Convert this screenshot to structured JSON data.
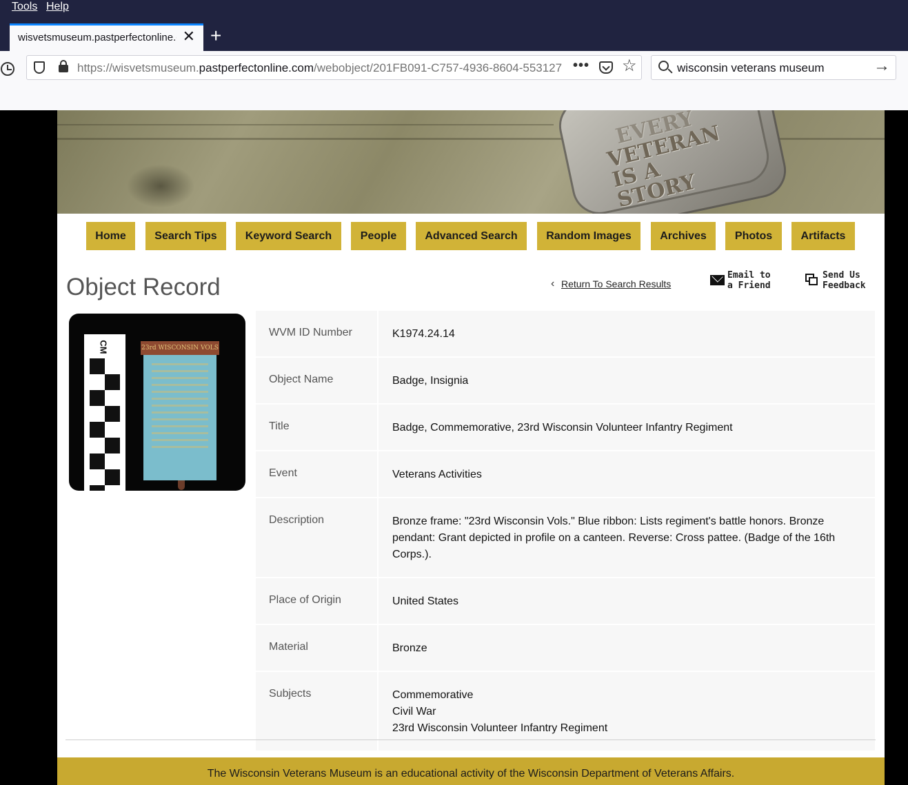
{
  "browser": {
    "menu": {
      "tools": "Tools",
      "help": "Help"
    },
    "tab": {
      "title": "wisvetsmuseum.pastperfectonline.com",
      "close": "✕"
    },
    "new_tab": "+",
    "url": {
      "prefix": "https://wisvetsmuseum.",
      "domain": "pastperfectonline.com",
      "path": "/webobject/201FB091-C757-4936-8604-553127"
    },
    "more": "•••",
    "search": {
      "value": "wisconsin veterans museum",
      "go": "→"
    },
    "star": "☆"
  },
  "banner": {
    "tag_lines": [
      "EVERY",
      "VETERAN",
      "IS A",
      "STORY"
    ]
  },
  "nav": [
    {
      "label": "Home"
    },
    {
      "label": "Search Tips"
    },
    {
      "label": "Keyword Search"
    },
    {
      "label": "People"
    },
    {
      "label": "Advanced Search"
    },
    {
      "label": "Random Images"
    },
    {
      "label": "Archives"
    },
    {
      "label": "Photos"
    },
    {
      "label": "Artifacts"
    }
  ],
  "record": {
    "title": "Object Record",
    "return_link": "Return To Search Results",
    "email": [
      "Email to",
      "a Friend"
    ],
    "feedback": [
      "Send Us",
      "Feedback"
    ],
    "image": {
      "ruler_label": "CM",
      "ribbon_top": "23rd WISCONSIN VOLS"
    },
    "fields": [
      {
        "label": "WVM ID Number",
        "value": [
          "K1974.24.14"
        ]
      },
      {
        "label": "Object Name",
        "value": [
          "Badge, Insignia"
        ]
      },
      {
        "label": "Title",
        "value": [
          "Badge, Commemorative, 23rd Wisconsin Volunteer Infantry Regiment"
        ]
      },
      {
        "label": "Event",
        "value": [
          "Veterans Activities"
        ]
      },
      {
        "label": "Description",
        "value": [
          "Bronze frame: \"23rd Wisconsin Vols.\" Blue ribbon: Lists regiment's battle honors. Bronze pendant: Grant depicted in profile on a canteen. Reverse: Cross pattee. (Badge of the 16th Corps.)."
        ]
      },
      {
        "label": "Place of Origin",
        "value": [
          "United States"
        ]
      },
      {
        "label": "Material",
        "value": [
          "Bronze"
        ]
      },
      {
        "label": "Subjects",
        "value": [
          "Commemorative",
          "Civil War",
          "23rd Wisconsin Volunteer Infantry Regiment"
        ]
      }
    ]
  },
  "footer": "The Wisconsin Veterans Museum is an educational activity of the Wisconsin Department of Veterans Affairs.",
  "colors": {
    "nav_button": "#d1b337",
    "footer": "#c8a930",
    "chrome_dark": "#202340"
  }
}
